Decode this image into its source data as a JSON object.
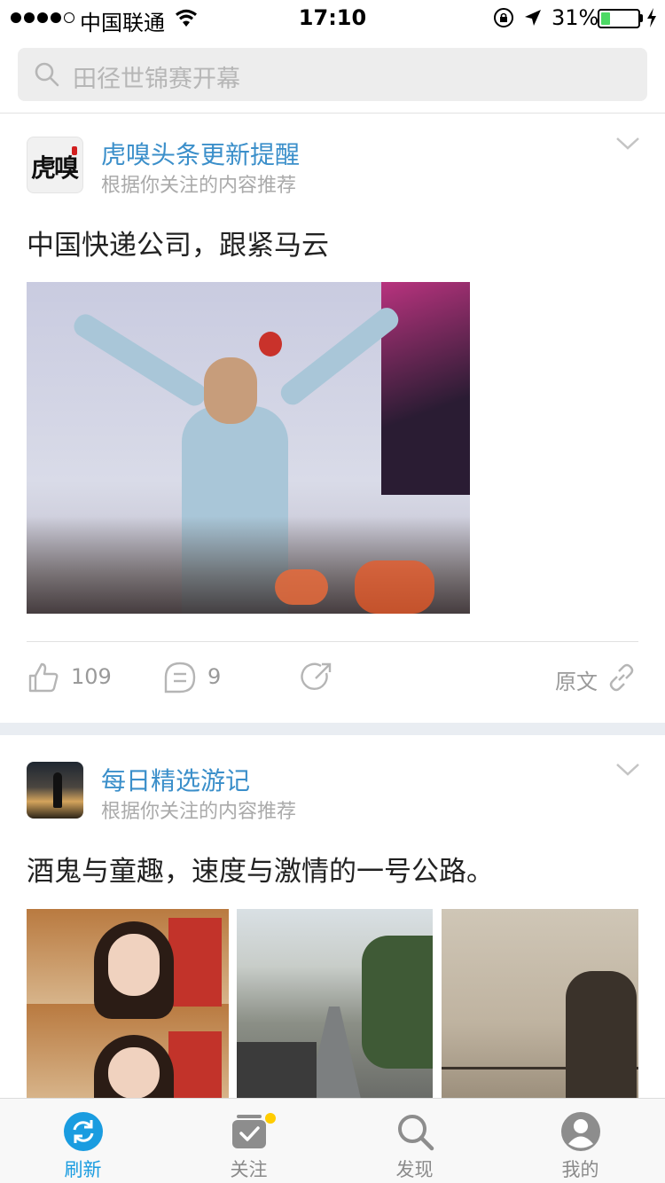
{
  "status_bar": {
    "carrier": "中国联通",
    "time": "17:10",
    "battery_percent_label": "31%",
    "battery_level": 0.31,
    "signal_bars_filled": 4,
    "signal_bars_total": 5
  },
  "search": {
    "placeholder": "田径世锦赛开幕",
    "icon": "search-icon"
  },
  "feed": [
    {
      "source": "虎嗅头条更新提醒",
      "avatar_text": "虎嗅",
      "reason": "根据你关注的内容推荐",
      "title": "中国快递公司，跟紧马云",
      "likes": "109",
      "comments": "9",
      "source_link_label": "原文"
    },
    {
      "source": "每日精选游记",
      "reason": "根据你关注的内容推荐",
      "title": "酒鬼与童趣，速度与激情的一号公路。"
    }
  ],
  "tabs": [
    {
      "label": "刷新",
      "icon": "refresh-icon",
      "active": true
    },
    {
      "label": "关注",
      "icon": "follow-icon",
      "active": false,
      "badge": true
    },
    {
      "label": "发现",
      "icon": "discover-icon",
      "active": false
    },
    {
      "label": "我的",
      "icon": "profile-icon",
      "active": false
    }
  ],
  "colors": {
    "accent": "#1a9ce0",
    "source_name": "#3b8fca",
    "battery_fill": "#4cd964",
    "badge": "#ffcc00"
  }
}
